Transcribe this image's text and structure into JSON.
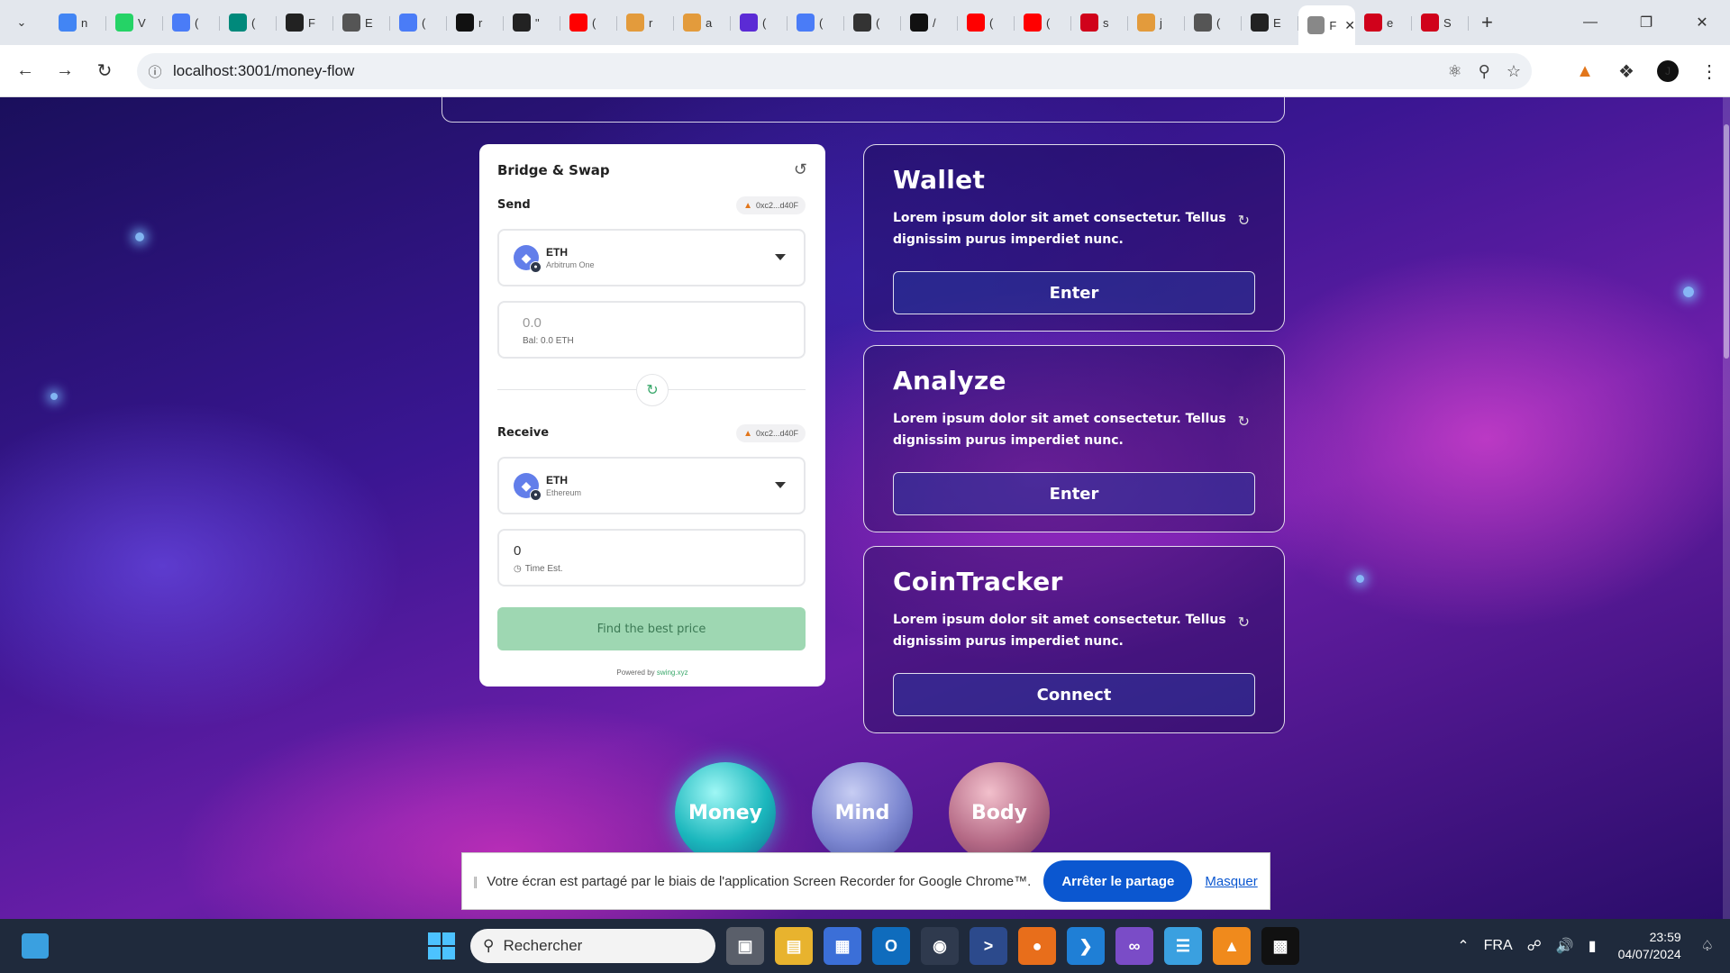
{
  "browser": {
    "tabs": [
      {
        "icon": "google-icon",
        "label": "n",
        "color": "#4285f4"
      },
      {
        "icon": "whatsapp-icon",
        "label": "V",
        "color": "#25d366"
      },
      {
        "icon": "gemini-icon",
        "label": "(",
        "color": "#4a7cf7"
      },
      {
        "icon": "meet-icon",
        "label": "(",
        "color": "#00897b"
      },
      {
        "icon": "github-icon",
        "label": "F",
        "color": "#222222"
      },
      {
        "icon": "globe-icon",
        "label": "E",
        "color": "#555555"
      },
      {
        "icon": "gemini-icon",
        "label": "(",
        "color": "#4a7cf7"
      },
      {
        "icon": "p-icon",
        "label": "r",
        "color": "#111111"
      },
      {
        "icon": "github-icon",
        "label": "\"",
        "color": "#222222"
      },
      {
        "icon": "youtube-icon",
        "label": "(",
        "color": "#ff0000"
      },
      {
        "icon": "hand-icon",
        "label": "r",
        "color": "#e39b3c"
      },
      {
        "icon": "hand-icon",
        "label": "a",
        "color": "#e39b3c"
      },
      {
        "icon": "code-icon",
        "label": "(",
        "color": "#5b2bd5"
      },
      {
        "icon": "gemini-icon",
        "label": "(",
        "color": "#4a7cf7"
      },
      {
        "icon": "openai-icon",
        "label": "(",
        "color": "#333333"
      },
      {
        "icon": "p-icon",
        "label": "/",
        "color": "#111111"
      },
      {
        "icon": "youtube-icon",
        "label": "(",
        "color": "#ff0000"
      },
      {
        "icon": "youtube-icon",
        "label": "(",
        "color": "#ff0000"
      },
      {
        "icon": "n-icon",
        "label": "s",
        "color": "#d0021b"
      },
      {
        "icon": "hand-icon",
        "label": "j",
        "color": "#e39b3c"
      },
      {
        "icon": "globe-icon",
        "label": "(",
        "color": "#555555"
      },
      {
        "icon": "github-icon",
        "label": "E",
        "color": "#222222"
      },
      {
        "icon": "page-icon",
        "label": "F",
        "color": "#888888",
        "active": true
      },
      {
        "icon": "n-icon",
        "label": "e",
        "color": "#d0021b"
      },
      {
        "icon": "record-icon",
        "label": "S",
        "color": "#d0021b"
      }
    ],
    "url": "localhost:3001/money-flow"
  },
  "bridge": {
    "title": "Bridge & Swap",
    "send_label": "Send",
    "receive_label": "Receive",
    "wallet_short": "0xc2...d40F",
    "send_token": {
      "symbol": "ETH",
      "network": "Arbitrum One"
    },
    "send_amount_placeholder": "0.0",
    "send_balance": "Bal: 0.0 ETH",
    "receive_token": {
      "symbol": "ETH",
      "network": "Ethereum"
    },
    "receive_amount": "0",
    "time_est": "Time Est.",
    "find_button": "Find the best price",
    "powered_prefix": "Powered by",
    "powered_link": "swing.xyz"
  },
  "cards": [
    {
      "title": "Wallet",
      "desc": "Lorem ipsum dolor sit amet consectetur. Tellus dignissim purus imperdiet nunc.",
      "button": "Enter"
    },
    {
      "title": "Analyze",
      "desc": "Lorem ipsum dolor sit amet consectetur. Tellus dignissim purus imperdiet nunc.",
      "button": "Enter"
    },
    {
      "title": "CoinTracker",
      "desc": "Lorem ipsum dolor sit amet consectetur. Tellus dignissim purus imperdiet nunc.",
      "button": "Connect"
    }
  ],
  "nav_orbs": {
    "money": "Money",
    "mind": "Mind",
    "body": "Body"
  },
  "share_bar": {
    "text": "Votre écran est partagé par le biais de l'application Screen Recorder for Google Chrome™.",
    "stop_button": "Arrêter le partage",
    "hide_link": "Masquer"
  },
  "taskbar": {
    "search_placeholder": "Rechercher",
    "language": "FRA",
    "time": "23:59",
    "date": "04/07/2024"
  },
  "colors": {
    "swap_accent": "#3aa86b",
    "find_button_bg": "#9ed7b2",
    "share_button_bg": "#0b57d0"
  }
}
